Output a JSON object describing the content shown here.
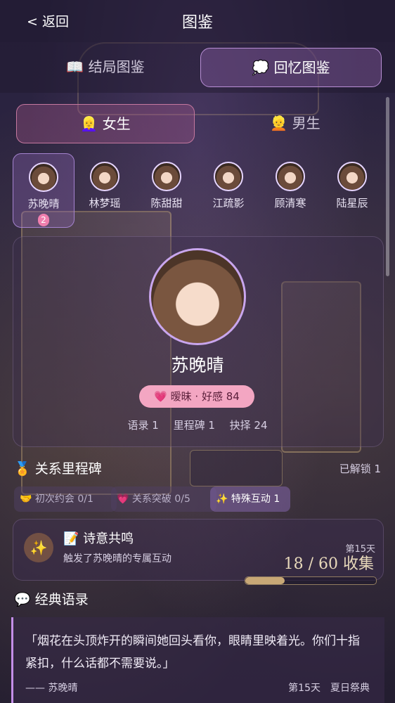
{
  "header": {
    "back_label": "< 返回",
    "title": "图鉴"
  },
  "main_tabs": [
    {
      "icon": "📖",
      "label": "结局图鉴"
    },
    {
      "icon": "💭",
      "label": "回忆图鉴"
    }
  ],
  "gender_tabs": [
    {
      "icon": "👱‍♀️",
      "label": "女生"
    },
    {
      "icon": "👱",
      "label": "男生"
    }
  ],
  "characters": [
    {
      "name": "苏晚晴",
      "badge": "2"
    },
    {
      "name": "林梦瑶"
    },
    {
      "name": "陈甜甜"
    },
    {
      "name": "江疏影"
    },
    {
      "name": "顾清寒"
    },
    {
      "name": "陆星辰"
    }
  ],
  "profile": {
    "name": "苏晚晴",
    "affinity_icon": "💗",
    "affinity": "暧昧 · 好感 84",
    "stats": [
      "语录 1",
      "里程碑 1",
      "抉择 24"
    ]
  },
  "milestones": {
    "icon": "🏅",
    "title": "关系里程碑",
    "unlocked": "已解锁 1",
    "chips": [
      {
        "icon": "🤝",
        "label": "初次约会 0/1"
      },
      {
        "icon": "💗",
        "label": "关系突破 0/5"
      },
      {
        "icon": "✨",
        "label": "特殊互动 1"
      }
    ]
  },
  "event": {
    "icon": "✨",
    "title": "📝 诗意共鸣",
    "desc": "触发了苏晚晴的专属互动",
    "day": "第15天",
    "collect": "18 / 60 收集",
    "progress": 0.3
  },
  "quotes": {
    "icon": "💬",
    "title": "经典语录",
    "text": "「烟花在头顶炸开的瞬间她回头看你，眼睛里映着光。你们十指紧扣，什么话都不需要说。」",
    "author": "—— 苏晚晴",
    "meta": "第15天　夏日祭典"
  },
  "colors": {
    "accent": "#b98fd6",
    "pink": "#f3a6c2",
    "gold": "#c8a876"
  }
}
